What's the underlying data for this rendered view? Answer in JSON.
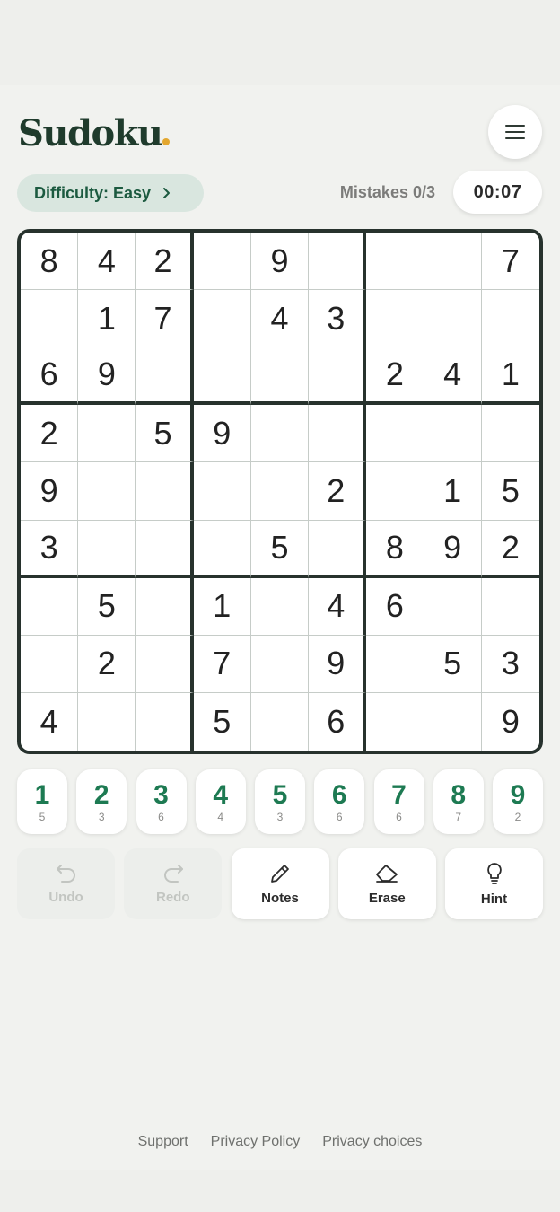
{
  "header": {
    "logo_text": "Sudoku",
    "logo_dot_color": "#e3a72f",
    "menu_icon": "hamburger-menu-icon"
  },
  "status": {
    "difficulty_label": "Difficulty: Easy",
    "mistakes_label": "Mistakes 0/3",
    "timer": "00:07"
  },
  "board": {
    "rows": [
      [
        "8",
        "4",
        "2",
        "",
        "9",
        "",
        "",
        "",
        "7"
      ],
      [
        "",
        "1",
        "7",
        "",
        "4",
        "3",
        "",
        "",
        ""
      ],
      [
        "6",
        "9",
        "",
        "",
        "",
        "",
        "2",
        "4",
        "1"
      ],
      [
        "2",
        "",
        "5",
        "9",
        "",
        "",
        "",
        "",
        ""
      ],
      [
        "9",
        "",
        "",
        "",
        "",
        "2",
        "",
        "1",
        "5"
      ],
      [
        "3",
        "",
        "",
        "",
        "5",
        "",
        "8",
        "9",
        "2"
      ],
      [
        "",
        "5",
        "",
        "1",
        "",
        "4",
        "6",
        "",
        ""
      ],
      [
        "",
        "2",
        "",
        "7",
        "",
        "9",
        "",
        "5",
        "3"
      ],
      [
        "4",
        "",
        "",
        "5",
        "",
        "6",
        "",
        "",
        "9"
      ]
    ]
  },
  "numpad": [
    {
      "digit": "1",
      "remaining": "5"
    },
    {
      "digit": "2",
      "remaining": "3"
    },
    {
      "digit": "3",
      "remaining": "6"
    },
    {
      "digit": "4",
      "remaining": "4"
    },
    {
      "digit": "5",
      "remaining": "3"
    },
    {
      "digit": "6",
      "remaining": "6"
    },
    {
      "digit": "7",
      "remaining": "6"
    },
    {
      "digit": "8",
      "remaining": "7"
    },
    {
      "digit": "9",
      "remaining": "2"
    }
  ],
  "actions": [
    {
      "label": "Undo",
      "icon": "undo-icon",
      "disabled": true
    },
    {
      "label": "Redo",
      "icon": "redo-icon",
      "disabled": true
    },
    {
      "label": "Notes",
      "icon": "pencil-icon",
      "disabled": false
    },
    {
      "label": "Erase",
      "icon": "eraser-icon",
      "disabled": false
    },
    {
      "label": "Hint",
      "icon": "lightbulb-icon",
      "disabled": false
    }
  ],
  "footer": {
    "support": "Support",
    "privacy_policy": "Privacy Policy",
    "privacy_choices": "Privacy choices"
  },
  "colors": {
    "accent_green": "#1d7a52",
    "board_border": "#27322d",
    "difficulty_bg": "#d9e6df"
  }
}
